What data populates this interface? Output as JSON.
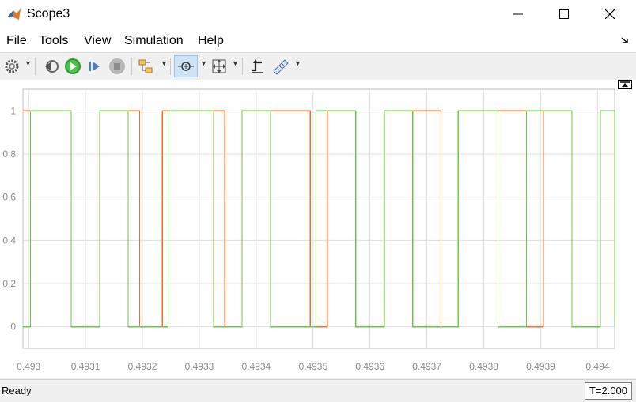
{
  "window": {
    "title": "Scope3",
    "app_icon": "matlab-icon",
    "controls": [
      "minimize-icon",
      "maximize-icon",
      "close-icon"
    ]
  },
  "menu": {
    "items": [
      "File",
      "Tools",
      "View",
      "Simulation",
      "Help"
    ]
  },
  "toolbar": {
    "buttons": [
      "configuration-properties",
      "step-back",
      "run",
      "step-forward",
      "stop",
      "highlight-simulink-block",
      "zoom",
      "fit-to-view",
      "triggers",
      "cursor-measurements"
    ]
  },
  "chart_data": {
    "type": "line",
    "x_ticks": [
      "0.493",
      "0.4931",
      "0.4932",
      "0.4933",
      "0.4934",
      "0.4935",
      "0.4936",
      "0.4937",
      "0.4938",
      "0.4939",
      "0.494"
    ],
    "y_ticks": [
      "0",
      "0.2",
      "0.4",
      "0.6",
      "0.8",
      "1"
    ],
    "xlim": [
      0.49299,
      0.49403
    ],
    "ylim": [
      -0.1,
      1.1
    ],
    "grid": true,
    "series": [
      {
        "color": "#ff6a26",
        "style": "square-wave",
        "high": [
          [
            0.49299,
            0.493075
          ],
          [
            0.493125,
            0.493195
          ],
          [
            0.493235,
            0.493345
          ],
          [
            0.493375,
            0.493495
          ],
          [
            0.493525,
            0.493575
          ],
          [
            0.493625,
            0.493725
          ],
          [
            0.493755,
            0.493875
          ],
          [
            0.493905,
            0.493955
          ],
          [
            0.494005,
            0.49403
          ]
        ]
      },
      {
        "color": "#6cc644",
        "style": "square-wave",
        "high": [
          [
            0.493003,
            0.493075
          ],
          [
            0.493125,
            0.493175
          ],
          [
            0.493245,
            0.493325
          ],
          [
            0.493375,
            0.493425
          ],
          [
            0.493505,
            0.493575
          ],
          [
            0.493625,
            0.493675
          ],
          [
            0.493755,
            0.493825
          ],
          [
            0.493875,
            0.493955
          ],
          [
            0.494005,
            0.494055
          ]
        ]
      }
    ]
  },
  "status": {
    "text": "Ready",
    "time": "T=2.000"
  },
  "colors": {
    "orange": "#ff6a26",
    "green": "#6cc644",
    "grid": "#e0e0e0"
  }
}
